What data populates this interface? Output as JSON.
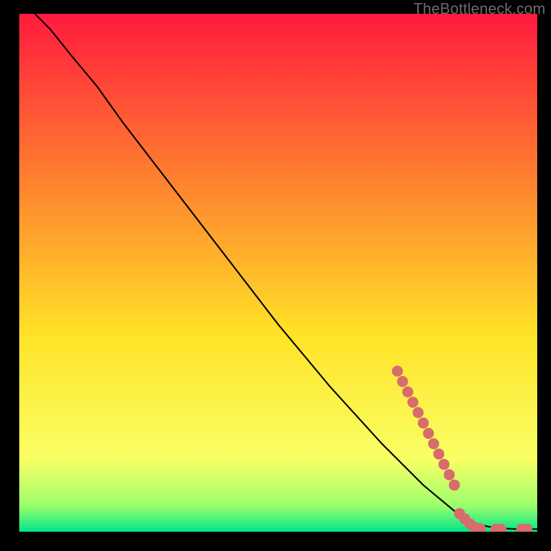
{
  "watermark": "TheBottleneck.com",
  "colors": {
    "top": "#ff1a3e",
    "mid1": "#ff8a2e",
    "mid2": "#ffe327",
    "mid3": "#f9ff65",
    "mid4": "#9bff6c",
    "bottom": "#00e58a",
    "curve": "#000000",
    "marker": "#d86b6b"
  },
  "chart_data": {
    "type": "line",
    "title": "",
    "xlabel": "",
    "ylabel": "",
    "xlim": [
      0,
      100
    ],
    "ylim": [
      0,
      100
    ],
    "curve": [
      {
        "x": 3,
        "y": 100
      },
      {
        "x": 6,
        "y": 97
      },
      {
        "x": 10,
        "y": 92
      },
      {
        "x": 15,
        "y": 86
      },
      {
        "x": 20,
        "y": 79
      },
      {
        "x": 30,
        "y": 66
      },
      {
        "x": 40,
        "y": 53
      },
      {
        "x": 50,
        "y": 40
      },
      {
        "x": 60,
        "y": 28
      },
      {
        "x": 70,
        "y": 17
      },
      {
        "x": 78,
        "y": 9
      },
      {
        "x": 84,
        "y": 4
      },
      {
        "x": 88,
        "y": 1.5
      },
      {
        "x": 92,
        "y": 0.7
      },
      {
        "x": 96,
        "y": 0.5
      },
      {
        "x": 100,
        "y": 0.5
      }
    ],
    "markers": [
      {
        "x": 73,
        "y": 31
      },
      {
        "x": 74,
        "y": 29
      },
      {
        "x": 75,
        "y": 27
      },
      {
        "x": 76,
        "y": 25
      },
      {
        "x": 77,
        "y": 23
      },
      {
        "x": 78,
        "y": 21
      },
      {
        "x": 79,
        "y": 19
      },
      {
        "x": 80,
        "y": 17
      },
      {
        "x": 81,
        "y": 15
      },
      {
        "x": 82,
        "y": 13
      },
      {
        "x": 83,
        "y": 11
      },
      {
        "x": 84,
        "y": 9
      },
      {
        "x": 85,
        "y": 3.5
      },
      {
        "x": 86,
        "y": 2.5
      },
      {
        "x": 87,
        "y": 1.5
      },
      {
        "x": 88,
        "y": 0.8
      },
      {
        "x": 89,
        "y": 0.6
      },
      {
        "x": 92,
        "y": 0.5
      },
      {
        "x": 93,
        "y": 0.5
      },
      {
        "x": 97,
        "y": 0.5
      },
      {
        "x": 98,
        "y": 0.5
      }
    ]
  }
}
